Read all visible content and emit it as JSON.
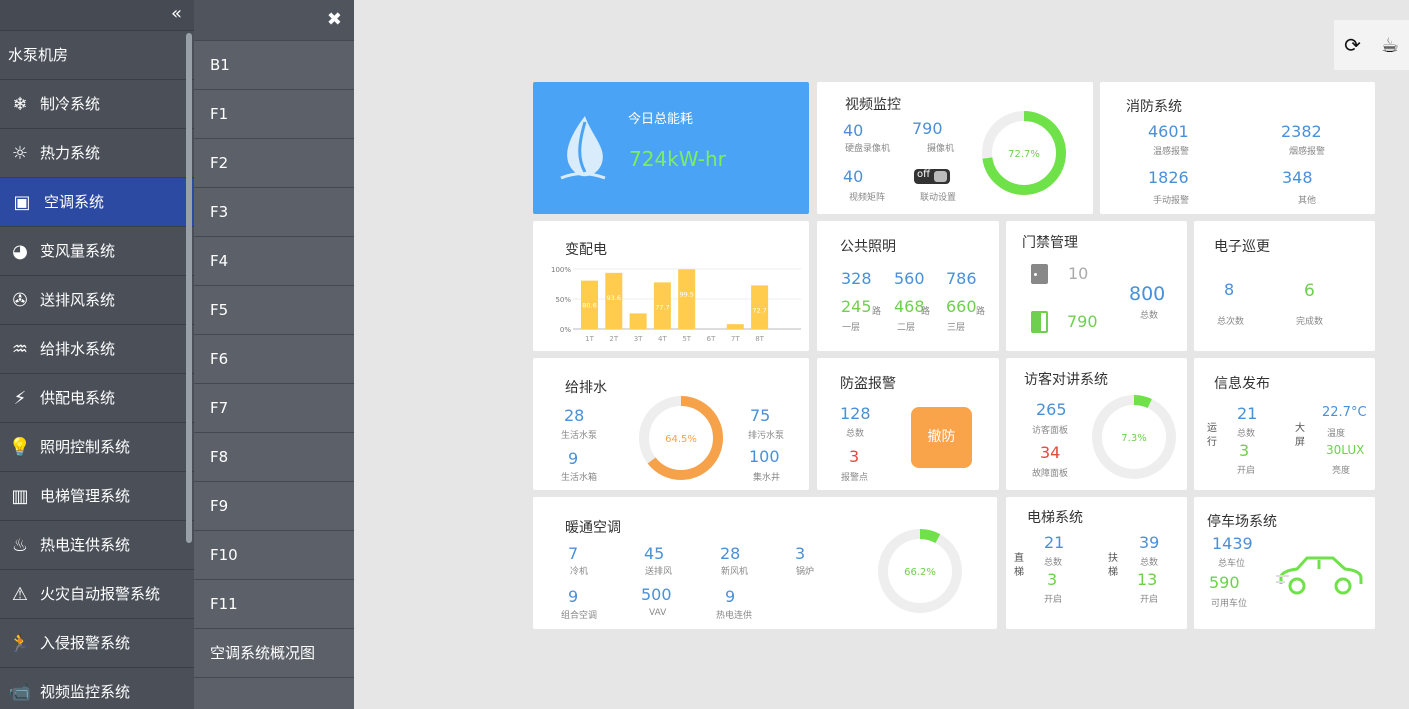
{
  "sidebar": {
    "collapse_icon": "«",
    "header": "水泵机房",
    "items": [
      {
        "icon": "snowflake-icon",
        "glyph": "❄",
        "label": "制冷系统"
      },
      {
        "icon": "sun-icon",
        "glyph": "☼",
        "label": "热力系统"
      },
      {
        "icon": "ac-unit-icon",
        "glyph": "▣",
        "label": "空调系统",
        "active": true
      },
      {
        "icon": "vav-icon",
        "glyph": "◕",
        "label": "变风量系统"
      },
      {
        "icon": "fan-icon",
        "glyph": "✇",
        "label": "送排风系统"
      },
      {
        "icon": "water-pump-icon",
        "glyph": "♒",
        "label": "给排水系统"
      },
      {
        "icon": "power-supply-icon",
        "glyph": "⚡",
        "label": "供配电系统"
      },
      {
        "icon": "bulb-icon",
        "glyph": "💡",
        "label": "照明控制系统"
      },
      {
        "icon": "elevator-icon",
        "glyph": "▥",
        "label": "电梯管理系统"
      },
      {
        "icon": "flame-icon",
        "glyph": "♨",
        "label": "热电连供系统"
      },
      {
        "icon": "fire-alarm-icon",
        "glyph": "⚠",
        "label": "火灾自动报警系统"
      },
      {
        "icon": "intruder-icon",
        "glyph": "🏃",
        "label": "入侵报警系统"
      },
      {
        "icon": "camera-icon",
        "glyph": "📹",
        "label": "视频监控系统"
      }
    ]
  },
  "floors": {
    "close_icon": "✖",
    "items": [
      "B1",
      "F1",
      "F2",
      "F3",
      "F4",
      "F5",
      "F6",
      "F7",
      "F8",
      "F9",
      "F10",
      "F11",
      "空调系统概况图"
    ]
  },
  "toolbar": {
    "refresh_icon": "⟳",
    "cup_icon": "☕"
  },
  "energy": {
    "title": "今日总能耗",
    "value": "724kW-hr",
    "icon": "leaf-icon"
  },
  "video": {
    "title": "视频监控",
    "nvr_value": "40",
    "nvr_label": "硬盘录像机",
    "camera_value": "790",
    "camera_label": "摄像机",
    "matrix_value": "40",
    "matrix_label": "视频矩阵",
    "link_toggle": "off",
    "link_label": "联动设置",
    "ring_percent": 72.7,
    "ring_label": "72.7%"
  },
  "fire": {
    "title": "消防系统",
    "temp_value": "4601",
    "temp_label": "温感报警",
    "smoke_value": "2382",
    "smoke_label": "烟感报警",
    "manual_value": "1826",
    "manual_label": "手动报警",
    "other_value": "348",
    "other_label": "其他"
  },
  "power": {
    "title": "变配电"
  },
  "chart_data": {
    "type": "bar",
    "categories": [
      "1T",
      "2T",
      "3T",
      "4T",
      "5T",
      "6T",
      "7T",
      "8T"
    ],
    "values": [
      80.6,
      93.6,
      26,
      77.7,
      99.5,
      0,
      8,
      72.7
    ],
    "labels": [
      "80.6",
      "93.6",
      "",
      "77.7",
      "99.5",
      "",
      "",
      "72.7"
    ],
    "ylim": [
      0,
      100
    ],
    "yticks": [
      "0%",
      "50%",
      "100%"
    ],
    "color": "#ffcc4d"
  },
  "lighting": {
    "title": "公共照明",
    "top": [
      "328",
      "560",
      "786"
    ],
    "loops": [
      "245",
      "468",
      "660"
    ],
    "loop_unit": "路",
    "floors": [
      "一层",
      "二层",
      "三层"
    ]
  },
  "access": {
    "title": "门禁管理",
    "closed_value": "10",
    "open_value": "790",
    "total_value": "800",
    "total_label": "总数"
  },
  "patrol": {
    "title": "电子巡更",
    "total_value": "8",
    "total_label": "总次数",
    "done_value": "6",
    "done_label": "完成数"
  },
  "water": {
    "title": "给排水",
    "domestic_pump_value": "28",
    "domestic_pump_label": "生活水泵",
    "drain_pump_value": "75",
    "drain_pump_label": "排污水泵",
    "tank_value": "9",
    "tank_label": "生活水箱",
    "well_value": "100",
    "well_label": "集水井",
    "ring_percent": 64.5,
    "ring_label": "64.5%"
  },
  "burglar": {
    "title": "防盗报警",
    "total_value": "128",
    "total_label": "总数",
    "alarm_value": "3",
    "alarm_label": "报警点",
    "disarm_label": "撤防"
  },
  "intercom": {
    "title": "访客对讲系统",
    "panel_value": "265",
    "panel_label": "访客面板",
    "fault_value": "34",
    "fault_label": "故障面板",
    "ring_percent": 7.3,
    "ring_label": "7.3%"
  },
  "info": {
    "title": "信息发布",
    "run_label": "运行",
    "total_value": "21",
    "total_label": "总数",
    "on_value": "3",
    "on_label": "开启",
    "screen_label": "大屏",
    "temp_value": "22.7°C",
    "temp_label": "温度",
    "lux_value": "30LUX",
    "lux_label": "亮度"
  },
  "hvac": {
    "title": "暖通空调",
    "items": [
      {
        "value": "7",
        "label": "冷机"
      },
      {
        "value": "45",
        "label": "送排风"
      },
      {
        "value": "28",
        "label": "新风机"
      },
      {
        "value": "3",
        "label": "锅炉"
      },
      {
        "value": "9",
        "label": "组合空调"
      },
      {
        "value": "500",
        "label": "VAV"
      },
      {
        "value": "9",
        "label": "热电连供"
      }
    ],
    "ring_percent": 66.2,
    "ring_label": "66.2%"
  },
  "elevator": {
    "title": "电梯系统",
    "lift_label": "直梯",
    "escalator_label": "扶梯",
    "lift_total": "21",
    "lift_on": "3",
    "esc_total": "39",
    "esc_on": "13",
    "total_label": "总数",
    "on_label": "开启"
  },
  "parking": {
    "title": "停车场系统",
    "total_value": "1439",
    "total_label": "总车位",
    "free_value": "590",
    "free_label": "可用车位",
    "icon": "car-icon"
  }
}
